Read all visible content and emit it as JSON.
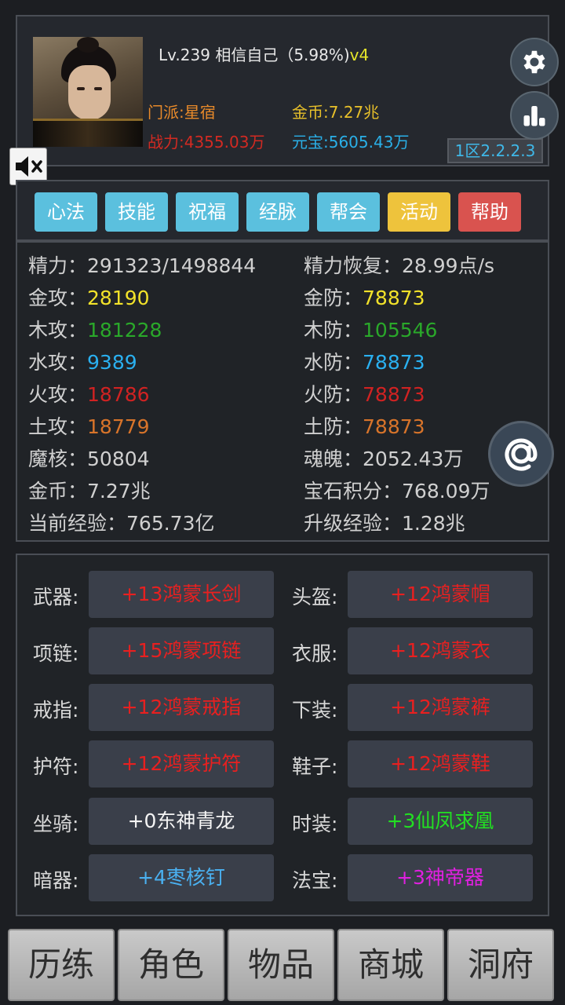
{
  "profile": {
    "level_text": "Lv.239 相信自己（5.98%)",
    "version": "v4",
    "sect": "门派:星宿",
    "gold": "金币:7.27兆",
    "power": "战力:4355.03万",
    "ingot": "元宝:5605.43万",
    "server": "1区2.2.2.3"
  },
  "tabs": [
    {
      "label": "心法"
    },
    {
      "label": "技能"
    },
    {
      "label": "祝福"
    },
    {
      "label": "经脉"
    },
    {
      "label": "帮会"
    },
    {
      "label": "活动"
    },
    {
      "label": "帮助"
    }
  ],
  "stats": {
    "left": [
      {
        "label": "精力：",
        "value": "291323/1498844",
        "color": "#d0d0d0"
      },
      {
        "label": "金攻：",
        "value": "28190",
        "color": "#f2e22a"
      },
      {
        "label": "木攻：",
        "value": "181228",
        "color": "#2aa82a"
      },
      {
        "label": "水攻：",
        "value": "9389",
        "color": "#2ab0f0"
      },
      {
        "label": "火攻：",
        "value": "18786",
        "color": "#d02222"
      },
      {
        "label": "土攻：",
        "value": "18779",
        "color": "#d8742a"
      },
      {
        "label": "魔核：",
        "value": "50804",
        "color": "#d0d0d0"
      },
      {
        "label": "金币：",
        "value": "7.27兆",
        "color": "#d0d0d0"
      },
      {
        "label": "当前经验：",
        "value": "765.73亿",
        "color": "#d0d0d0"
      }
    ],
    "right": [
      {
        "label": "精力恢复：",
        "value": "28.99点/s",
        "color": "#d0d0d0"
      },
      {
        "label": "金防：",
        "value": "78873",
        "color": "#f2e22a"
      },
      {
        "label": "木防：",
        "value": "105546",
        "color": "#2aa82a"
      },
      {
        "label": "水防：",
        "value": "78873",
        "color": "#2ab0f0"
      },
      {
        "label": "火防：",
        "value": "78873",
        "color": "#d02222"
      },
      {
        "label": "土防：",
        "value": "78873",
        "color": "#d8742a"
      },
      {
        "label": "魂魄：",
        "value": "2052.43万",
        "color": "#d0d0d0"
      },
      {
        "label": "宝石积分：",
        "value": "768.09万",
        "color": "#d0d0d0"
      },
      {
        "label": "升级经验：",
        "value": "1.28兆",
        "color": "#d0d0d0"
      }
    ]
  },
  "equipment": {
    "left": [
      {
        "slot": "武器:",
        "item": "+13鸿蒙长剑",
        "color": "#e82020"
      },
      {
        "slot": "项链:",
        "item": "+15鸿蒙项链",
        "color": "#e82020"
      },
      {
        "slot": "戒指:",
        "item": "+12鸿蒙戒指",
        "color": "#e82020"
      },
      {
        "slot": "护符:",
        "item": "+12鸿蒙护符",
        "color": "#e82020"
      },
      {
        "slot": "坐骑:",
        "item": "+0东神青龙",
        "color": "#f4f4f4"
      },
      {
        "slot": "暗器:",
        "item": "+4枣核钉",
        "color": "#4ab0f0"
      }
    ],
    "right": [
      {
        "slot": "头盔:",
        "item": "+12鸿蒙帽",
        "color": "#e82020"
      },
      {
        "slot": "衣服:",
        "item": "+12鸿蒙衣",
        "color": "#e82020"
      },
      {
        "slot": "下装:",
        "item": "+12鸿蒙裤",
        "color": "#e82020"
      },
      {
        "slot": "鞋子:",
        "item": "+12鸿蒙鞋",
        "color": "#e82020"
      },
      {
        "slot": "时装:",
        "item": "+3仙凤求凰",
        "color": "#22e022"
      },
      {
        "slot": "法宝:",
        "item": "+3神帝器",
        "color": "#e020e0"
      }
    ]
  },
  "nav": [
    {
      "label": "历练"
    },
    {
      "label": "角色"
    },
    {
      "label": "物品"
    },
    {
      "label": "商城"
    },
    {
      "label": "洞府"
    }
  ],
  "icons": {
    "settings": "gear-icon",
    "ranking": "bar-chart-icon",
    "mute": "speaker-muted-icon",
    "mention": "at-sign-icon"
  }
}
